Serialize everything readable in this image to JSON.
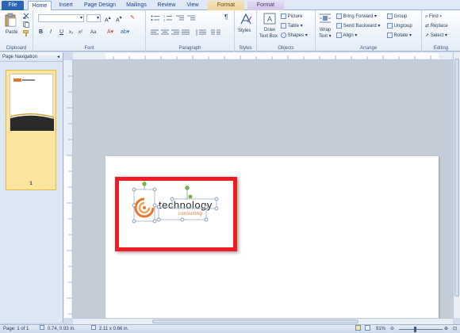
{
  "tabs": {
    "file": "File",
    "home": "Home",
    "insert": "Insert",
    "page_design": "Page Design",
    "mailings": "Mailings",
    "review": "Review",
    "view": "View",
    "format_drawing": "Format",
    "format_picture": "Format"
  },
  "ribbon": {
    "clipboard": {
      "paste": "Paste",
      "label": "Clipboard"
    },
    "font": {
      "label": "Font",
      "bold": "B",
      "italic": "I",
      "underline": "U",
      "sub": "x₂",
      "sup": "x²",
      "clear": "Aa"
    },
    "paragraph": {
      "label": "Paragraph",
      "pilcrow": "¶"
    },
    "styles": {
      "button": "Styles",
      "label": "Styles"
    },
    "objects": {
      "draw_text_box_line1": "Draw",
      "draw_text_box_line2": "Text Box",
      "picture": "Picture",
      "table": "Table ▾",
      "shapes": "Shapes ▾",
      "label": "Objects"
    },
    "arrange": {
      "wrap_text_line1": "Wrap",
      "wrap_text_line2": "Text ▾",
      "bring_forward": "Bring Forward ▾",
      "send_backward": "Send Backward ▾",
      "align": "Align ▾",
      "group": "Group",
      "ungroup": "Ungroup",
      "rotate": "Rotate ▾",
      "label": "Arrange"
    },
    "editing": {
      "find": "Find ▾",
      "replace": "Replace",
      "select": "Select ▾",
      "label": "Editing"
    }
  },
  "nav": {
    "title": "Page Navigation",
    "collapse": "◂",
    "page_number": "1"
  },
  "page": {
    "logo_word": "technology",
    "logo_sub": "consulting"
  },
  "status": {
    "page": "Page: 1 of 1",
    "position": "0.74, 0.93 in.",
    "size": "2.11 x 0.66 in.",
    "zoom": "91%"
  },
  "colors": {
    "highlight": "#ee1d23",
    "file_tab": "#2a64b3",
    "logo_orange": "#e8762b"
  }
}
